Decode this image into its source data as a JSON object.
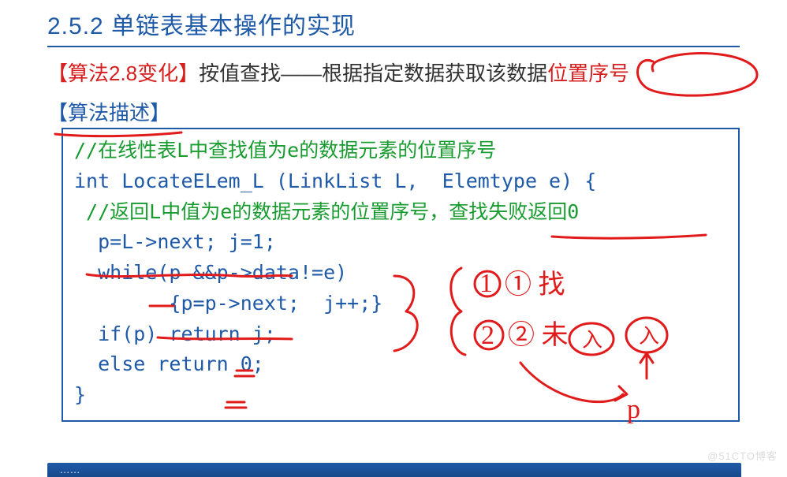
{
  "heading": "2.5.2 单链表基本操作的实现",
  "topic_line": {
    "bracket_label": "【算法2.8变化】",
    "text_main": "按值查找——根据指定数据获取该数据",
    "text_highlight": "位置序号"
  },
  "desc_label": "【算法描述】",
  "code": {
    "c1": "//在线性表L中查找值为e的数据元素的位置序号",
    "l1": "int LocateELem_L (LinkList L,  Elemtype e) {",
    "c2": " //返回L中值为e的数据元素的位置序号，查找失败返回0",
    "l2": "  p=L->next; j=1;",
    "l3": "  while(p &&p->data!=e)",
    "l4": "        {p=p->next;  j++;}",
    "l5": "  if(p) return j;",
    "l6": "  else return 0;",
    "l7": "}"
  },
  "annotations": {
    "note1": "① 找",
    "note2": "② 未",
    "colors": {
      "pen": "#e11b1b"
    }
  },
  "watermark": "@51CTO博客",
  "bottom_bar": "……"
}
